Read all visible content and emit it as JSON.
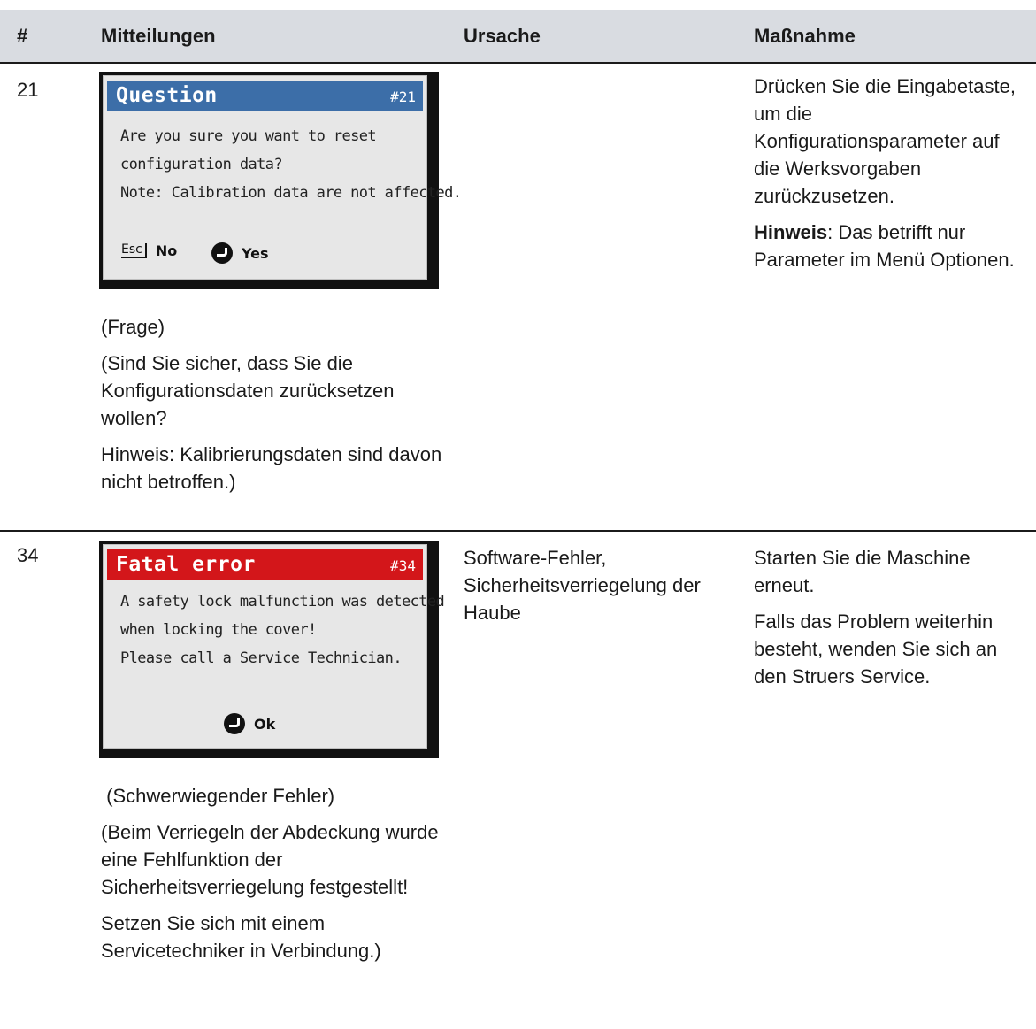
{
  "header": {
    "col_num": "#",
    "col_messages": "Mitteilungen",
    "col_cause": "Ursache",
    "col_action": "Maßnahme"
  },
  "colors": {
    "question_title_bg": "#3c6ea8",
    "fatal_title_bg": "#d3161a",
    "header_bg": "#d9dce1"
  },
  "rows": [
    {
      "num": "21",
      "screen": {
        "title": "Question",
        "code": "#21",
        "lines": [
          "Are you sure you want to reset",
          "configuration data?",
          "Note: Calibration data are not affected."
        ],
        "esc_label": "Esc",
        "no_label": "No",
        "yes_label": "Yes",
        "icons": [
          "esc-key-icon",
          "enter-key-icon"
        ]
      },
      "texts": [
        "(Frage)",
        "(Sind Sie sicher, dass Sie die Konfigurationsdaten zurücksetzen wollen?",
        "Hinweis: Kalibrierungsdaten sind davon nicht betroffen.)"
      ],
      "cause": "",
      "action": {
        "p1": "Drücken Sie die Eingabetaste, um die Konfigurationsparameter auf die Werksvorgaben zurückzusetzen.",
        "note_label": "Hinweis",
        "note_text": ": Das betrifft nur Parameter im Menü Optionen."
      }
    },
    {
      "num": "34",
      "screen": {
        "title": "Fatal error",
        "code": "#34",
        "lines": [
          "A safety lock malfunction was detected",
          "when locking the cover!",
          "Please call a Service Technician."
        ],
        "ok_label": "Ok",
        "icons": [
          "enter-key-icon"
        ]
      },
      "texts": [
        " (Schwerwiegender Fehler)",
        "(Beim Verriegeln der Abdeckung wurde eine Fehlfunktion der Sicherheitsverriegelung festgestellt!",
        "Setzen Sie sich mit einem Servicetechniker in Verbindung.)"
      ],
      "cause": "Software-Fehler, Sicherheitsverriegelung der Haube",
      "action": {
        "p1": "Starten Sie die Maschine erneut.",
        "p2": "Falls das Problem weiterhin besteht, wenden Sie sich an den Struers Service."
      }
    }
  ]
}
